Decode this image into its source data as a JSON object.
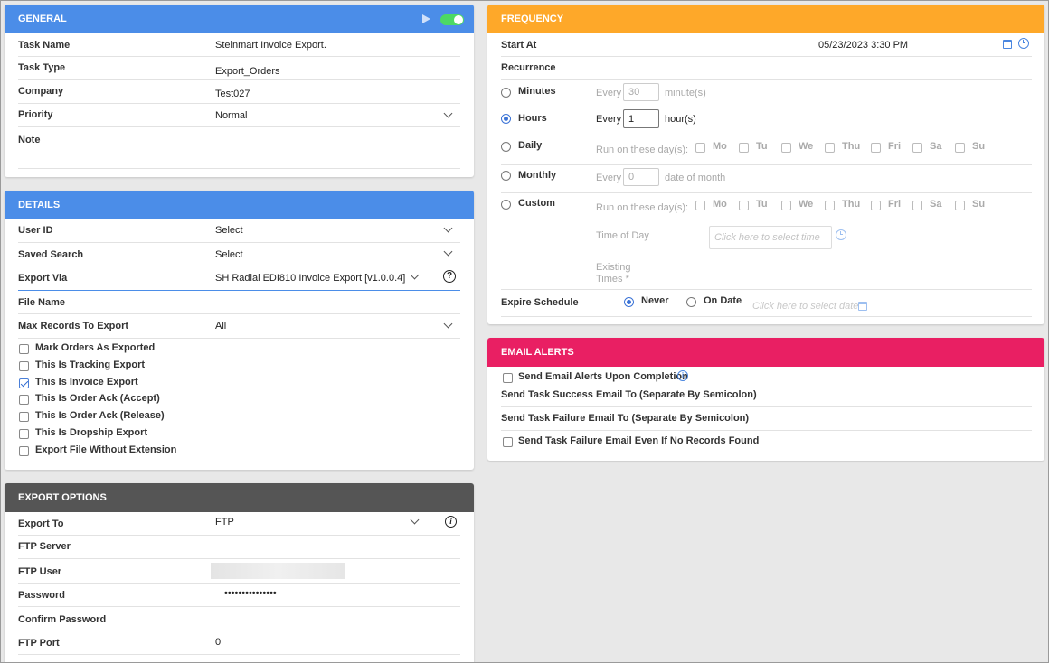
{
  "general": {
    "header": "GENERAL",
    "task_name_label": "Task Name",
    "task_name": "Steinmart Invoice Export.",
    "task_type_label": "Task Type",
    "task_type": "Export_Orders",
    "company_label": "Company",
    "company": "Test027",
    "priority_label": "Priority",
    "priority": "Normal",
    "note_label": "Note"
  },
  "details": {
    "header": "DETAILS",
    "user_id_label": "User ID",
    "user_id": "Select",
    "saved_search_label": "Saved Search",
    "saved_search": "Select",
    "export_via_label": "Export Via",
    "export_via": "SH Radial EDI810 Invoice Export [v1.0.0.4]",
    "file_name_label": "File Name",
    "max_records_label": "Max Records To Export",
    "max_records": "All",
    "checks": [
      {
        "label": "Mark Orders As Exported",
        "checked": false
      },
      {
        "label": "This Is Tracking Export",
        "checked": false
      },
      {
        "label": "This Is Invoice Export",
        "checked": true
      },
      {
        "label": "This Is Order Ack (Accept)",
        "checked": false
      },
      {
        "label": "This Is Order Ack (Release)",
        "checked": false
      },
      {
        "label": "This Is Dropship Export",
        "checked": false
      },
      {
        "label": "Export File Without Extension",
        "checked": false
      }
    ]
  },
  "export": {
    "header": "EXPORT OPTIONS",
    "export_to_label": "Export To",
    "export_to": "FTP",
    "ftp_server_label": "FTP Server",
    "ftp_user_label": "FTP User",
    "password_label": "Password",
    "password": "•••••••••••••••",
    "confirm_label": "Confirm Password",
    "port_label": "FTP Port",
    "port": "0"
  },
  "frequency": {
    "header": "FREQUENCY",
    "start_label": "Start At",
    "start": "05/23/2023 3:30 PM",
    "recurrence_label": "Recurrence",
    "minutes_label": "Minutes",
    "every": "Every",
    "minutes_value": "30",
    "minutes_unit": "minute(s)",
    "hours_label": "Hours",
    "hours_value": "1",
    "hours_unit": "hour(s)",
    "daily_label": "Daily",
    "run_days": "Run on these day(s):",
    "days": [
      "Mo",
      "Tu",
      "We",
      "Thu",
      "Fri",
      "Sa",
      "Su"
    ],
    "monthly_label": "Monthly",
    "monthly_value": "0",
    "monthly_unit": "date of month",
    "custom_label": "Custom",
    "time_of_day": "Time of Day",
    "time_placeholder": "Click here to select time",
    "existing_1": "Existing",
    "existing_2": "Times *",
    "expire_label": "Expire Schedule",
    "never": "Never",
    "on_date": "On Date",
    "date_placeholder": "Click here to select date"
  },
  "email": {
    "header": "EMAIL ALERTS",
    "send_alerts": "Send Email Alerts Upon Completion",
    "success_to": "Send Task Success Email To (Separate By Semicolon)",
    "failure_to": "Send Task Failure Email To (Separate By Semicolon)",
    "failure_no_records": "Send Task Failure Email Even If No Records Found"
  }
}
